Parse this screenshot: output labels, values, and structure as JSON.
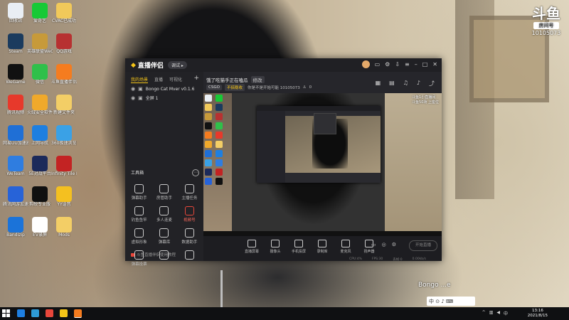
{
  "desktop": {
    "icons": [
      {
        "label": "回收站",
        "color": "#e9eef4"
      },
      {
        "label": "爱奇艺",
        "color": "#17c936"
      },
      {
        "label": "CVAC已成功",
        "color": "#f1c95a"
      },
      {
        "label": "Steam",
        "color": "#1b3b5e"
      },
      {
        "label": "英雄联盟WeGame版",
        "color": "#c79a3a"
      },
      {
        "label": "QQ游戏",
        "color": "#b73131"
      },
      {
        "label": "WeGame",
        "color": "#111111"
      },
      {
        "label": "微信",
        "color": "#2fc04a"
      },
      {
        "label": "斗鱼直播伴侣",
        "color": "#f57c1f"
      },
      {
        "label": "腾讯视频",
        "color": "#e7392b"
      },
      {
        "label": "火绒安全软件",
        "color": "#f0a92b"
      },
      {
        "label": "新建文件夹",
        "color": "#f3ce66"
      },
      {
        "label": "网易UU加速器",
        "color": "#1f6fd6"
      },
      {
        "label": "上网导航",
        "color": "#1e7fe0"
      },
      {
        "label": "360极速浏览器",
        "color": "#3aa1e6"
      },
      {
        "label": "WeTeam",
        "color": "#2f7de0"
      },
      {
        "label": "5E对战平台",
        "color": "#1c2a5a"
      },
      {
        "label": "Infinity Tile Pro",
        "color": "#c32323"
      },
      {
        "label": "腾讯网游加速器",
        "color": "#2763d8"
      },
      {
        "label": "剪映专业版",
        "color": "#101010"
      },
      {
        "label": "YY语音",
        "color": "#f4c020"
      },
      {
        "label": "Bandizip",
        "color": "#1b73d9"
      },
      {
        "label": "EV录屏",
        "color": "#ffffff"
      },
      {
        "label": "Mods",
        "color": "#f3ce66"
      }
    ]
  },
  "watermark": {
    "logo": "斗鱼",
    "room_tag": "房间号",
    "room_number": "10105073"
  },
  "overlay": {
    "bongo_text": "Bongo ...e"
  },
  "app": {
    "name": "直播伴侣",
    "version_pill": "调试 ▸",
    "title_icons": [
      "头像",
      "消息",
      "设置",
      "下载",
      "菜单",
      "最小化",
      "最大化",
      "关闭"
    ],
    "left": {
      "tabs": [
        "我的场景",
        "直播",
        "可视化"
      ],
      "active_tab": "我的场景",
      "plus": "+",
      "scenes": [
        "Bongo Cat Mver v0.1.6",
        "全屏 1"
      ],
      "tools_title": "工具箱",
      "tools": [
        {
          "label": "弹幕助手",
          "hot": false
        },
        {
          "label": "房管助手",
          "hot": false
        },
        {
          "label": "主播任务",
          "hot": false
        },
        {
          "label": "钓鱼鱼竿",
          "hot": false
        },
        {
          "label": "多人连麦",
          "hot": false
        },
        {
          "label": "视频号",
          "hot": true
        },
        {
          "label": "虚拟形象",
          "hot": false
        },
        {
          "label": "弹幕库",
          "hot": false
        },
        {
          "label": "数据助手",
          "hot": false
        },
        {
          "label": "弹幕投票",
          "hot": false
        },
        {
          "label": "",
          "hot": false
        },
        {
          "label": "",
          "hot": false
        }
      ],
      "footer": "斗鱼直播伴侣使用教程"
    },
    "main": {
      "room_title": "饿了吃猫手正在嗑瓜",
      "edit_label": "修改",
      "category": "CSGO",
      "category_sub": "不搞稳收",
      "room_meta": "你是不是开始可能 10105073",
      "viewer_count": "0",
      "header_icons": [
        "场景",
        "画面",
        "音频",
        "通知",
        "分享"
      ],
      "preview_corner": "斗鱼1小直播间\n斗鱼50场 上座位",
      "controls": [
        {
          "label": "直播屏幕"
        },
        {
          "label": "摄像头"
        },
        {
          "label": "手机投屏"
        },
        {
          "label": "录制库"
        },
        {
          "label": "麦克风"
        },
        {
          "label": "扬声器"
        }
      ],
      "right_controls": [
        "录像",
        "特效",
        "设置"
      ],
      "start_button": "开始直播",
      "status": [
        "CPU:4%",
        "FPS:30",
        "丢帧:0",
        "0.00kb/s"
      ]
    }
  },
  "taskbar": {
    "apps": [
      {
        "color": "#1e7fe0"
      },
      {
        "color": "#2e9bd6"
      },
      {
        "color": "#e8473b"
      },
      {
        "color": "#f5c518"
      },
      {
        "color": "#f57c1f"
      }
    ],
    "tray_ime": "中 ⊙ ♪ ⌨",
    "clock_time": "13:16",
    "clock_date": "2021/8/15"
  }
}
